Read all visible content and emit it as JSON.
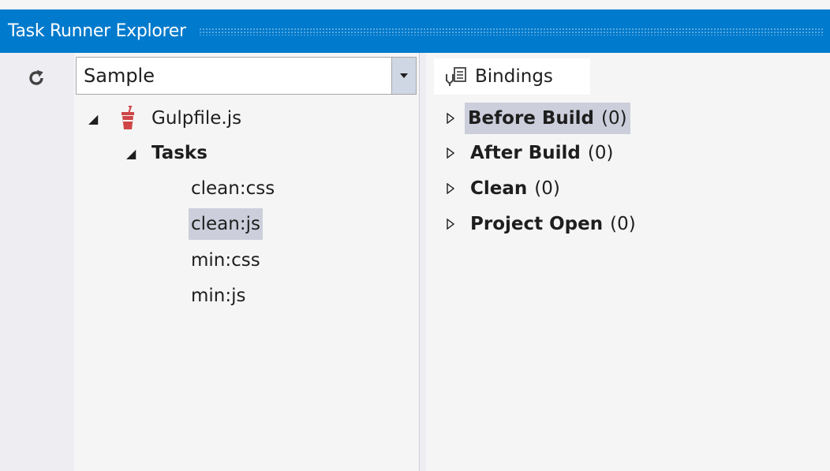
{
  "window": {
    "title": "Task Runner Explorer"
  },
  "toolbar": {
    "refresh_icon": "refresh-icon"
  },
  "project_selector": {
    "value": "Sample"
  },
  "tree": {
    "root": {
      "label": "Gulpfile.js",
      "icon": "gulp-icon",
      "expanded": true
    },
    "group": {
      "label": "Tasks",
      "expanded": true
    },
    "tasks": [
      {
        "label": "clean:css",
        "selected": false
      },
      {
        "label": "clean:js",
        "selected": true
      },
      {
        "label": "min:css",
        "selected": false
      },
      {
        "label": "min:js",
        "selected": false
      }
    ]
  },
  "bindings_tab": {
    "label": "Bindings",
    "icon": "bindings-icon"
  },
  "bindings": [
    {
      "name": "Before Build",
      "count": "(0)",
      "selected": true
    },
    {
      "name": "After Build",
      "count": "(0)",
      "selected": false
    },
    {
      "name": "Clean",
      "count": "(0)",
      "selected": false
    },
    {
      "name": "Project Open",
      "count": "(0)",
      "selected": false
    }
  ],
  "colors": {
    "titlebar": "#007acc",
    "selection": "#cccedb",
    "panel": "#f5f5f5",
    "gulp": "#cf4647"
  }
}
